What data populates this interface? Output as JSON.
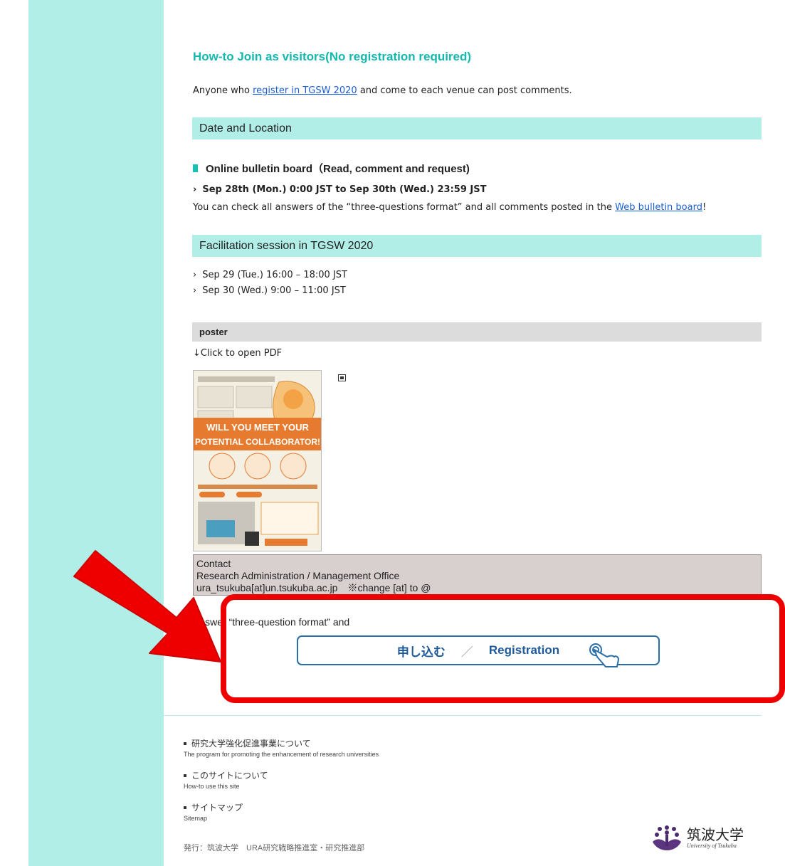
{
  "page": {
    "heading": "How-to Join as visitors(No registration required)",
    "intro": {
      "before": "Anyone who ",
      "link": "register in TGSW 2020",
      "after": " and come to each venue can post comments."
    }
  },
  "date_location": {
    "title": "Date and Location",
    "online_board_label": "Online bulletin board（Read, comment and request)",
    "period": "Sep 28th (Mon.) 0:00 JST to Sep 30th (Wed.) 23:59 JST",
    "check_text_before": "You can check all answers of the “three-questions format” and all comments posted in the ",
    "check_link": "Web bulletin board",
    "check_text_after": "!"
  },
  "facilitation": {
    "title": "Facilitation session in TGSW 2020",
    "sessions": [
      "Sep 29 (Tue.) 16:00 – 18:00 JST",
      "Sep 30 (Wed.) 9:00 – 11:00 JST"
    ]
  },
  "poster": {
    "title": "poster",
    "hint": "↓Click to open PDF",
    "thumb": {
      "line1": "WILL YOU MEET YOUR",
      "line2": "POTENTIAL COLLABORATOR!"
    }
  },
  "contact": {
    "label": "Contact",
    "office": "Research Administration / Management Office",
    "email": "ura_tsukuba[at]un.tsukuba.ac.jp　※change [at] to @"
  },
  "answer": {
    "text": "Answer “three-question format” and"
  },
  "registration": {
    "jp": "申し込む",
    "separator": "／",
    "en": "Registration"
  },
  "footer": {
    "items": [
      {
        "jp": "研究大学強化促進事業について",
        "en": "The program for promoting the enhancement of research universities"
      },
      {
        "jp": "このサイトについて",
        "en": "How-to use this site"
      },
      {
        "jp": "サイトマップ",
        "en": "Sitemap"
      }
    ],
    "publisher": "発行：筑波大学　URA研究戦略推進室・研究推進部"
  },
  "logo": {
    "jp": "筑波大学",
    "en": "University of Tsukuba"
  },
  "colors": {
    "teal_bg": "#b2eee8",
    "heading_teal": "#14b8b0",
    "link_blue": "#1a5fd6",
    "button_blue": "#1e5a9a",
    "highlight_red": "#ee0000"
  }
}
